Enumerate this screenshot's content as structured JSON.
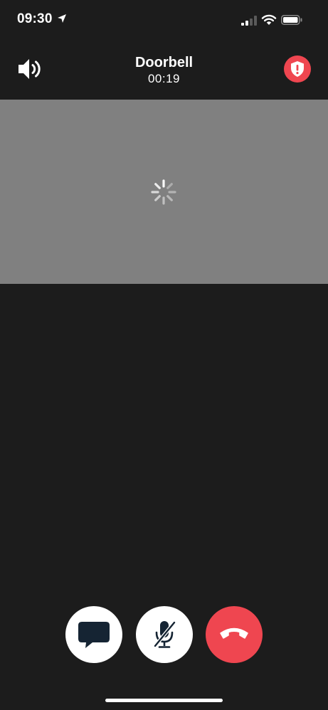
{
  "status_bar": {
    "time": "09:30",
    "icons": [
      "location-arrow-icon",
      "signal-icon",
      "wifi-icon",
      "battery-icon"
    ]
  },
  "call": {
    "caller_name": "Doorbell",
    "duration": "00:19"
  },
  "header_icons": {
    "left": "speaker-icon",
    "right": "shield-alert-icon"
  },
  "video": {
    "state_icon": "loading-spinner-icon"
  },
  "controls": [
    {
      "name": "message-button",
      "icon": "chat-bubble-icon"
    },
    {
      "name": "mute-button",
      "icon": "microphone-muted-icon"
    },
    {
      "name": "hangup-button",
      "icon": "phone-hangup-icon"
    }
  ],
  "colors": {
    "background": "#1c1c1c",
    "video_placeholder": "#808080",
    "accent_red": "#ef4650",
    "button_white": "#ffffff",
    "icon_dark": "#152433"
  }
}
